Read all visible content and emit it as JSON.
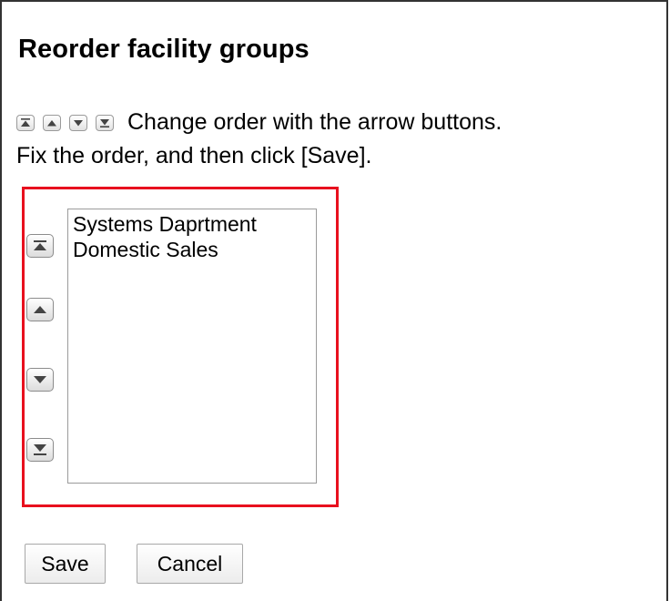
{
  "dialog": {
    "title": "Reorder facility groups",
    "instruction_line1": "Change order with the arrow buttons.",
    "instruction_line2": "Fix the order, and then click [Save]."
  },
  "icons": {
    "top": "move-to-top-icon",
    "up": "move-up-icon",
    "down": "move-down-icon",
    "bottom": "move-to-bottom-icon"
  },
  "order_list": {
    "items": [
      {
        "label": "Systems Daprtment"
      },
      {
        "label": "Domestic Sales"
      }
    ]
  },
  "actions": {
    "save_label": "Save",
    "cancel_label": "Cancel"
  },
  "colors": {
    "highlight_border": "#e8101e",
    "frame_border": "#333333"
  }
}
